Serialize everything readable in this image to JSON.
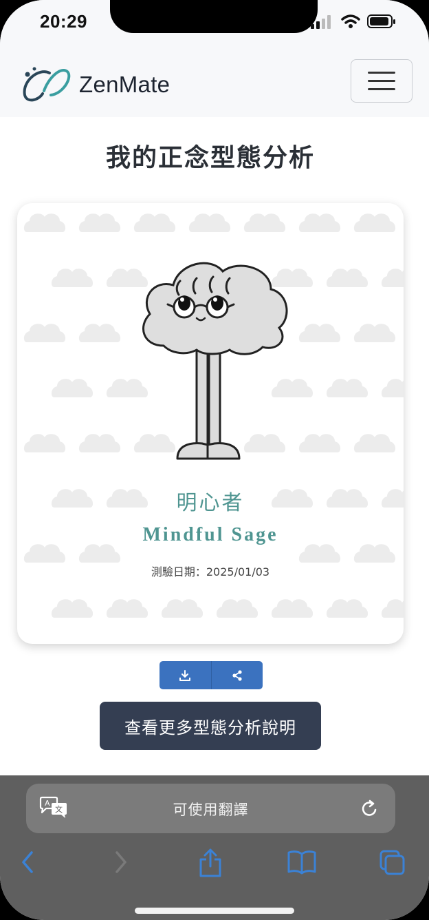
{
  "status_bar": {
    "time": "20:29"
  },
  "navbar": {
    "brand": "ZenMate",
    "menu_icon": "hamburger-menu-icon"
  },
  "page": {
    "title": "我的正念型態分析"
  },
  "result_card": {
    "type_name_cn": "明心者",
    "type_name_en": "Mindful Sage",
    "test_date": "測驗日期：2025/01/03",
    "accent_color": "#4f9591"
  },
  "actions": {
    "download_icon": "download-icon",
    "share_icon": "share-icon",
    "more_label": "查看更多型態分析說明"
  },
  "browser": {
    "url_bar_text": "可使用翻譯",
    "toolbar_icons": [
      "back-icon",
      "forward-icon",
      "share-icon",
      "bookmarks-icon",
      "tabs-icon"
    ]
  }
}
